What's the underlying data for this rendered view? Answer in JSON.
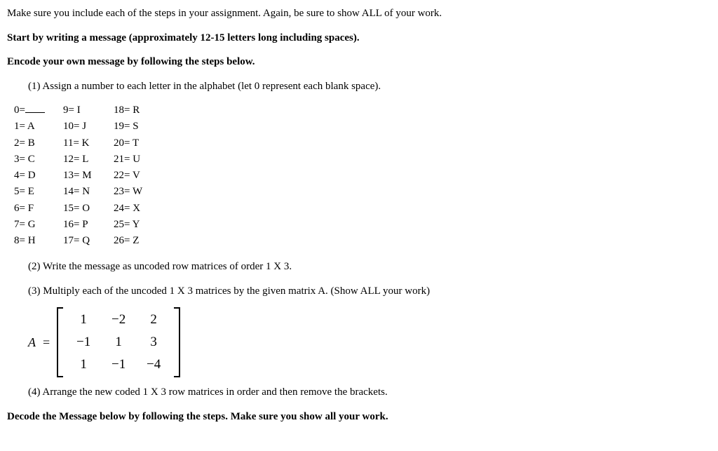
{
  "intro": "Make sure you include each of the steps in your assignment.  Again, be sure to show ALL of your work.",
  "start_msg": "Start by writing a message (approximately 12-15 letters long including spaces).",
  "encode_instr": "Encode your own message by following the steps below.",
  "step1": "(1) Assign a number to each letter in the alphabet (let 0 represent each blank space).",
  "alpha_table": {
    "col1": [
      "0=",
      "1= A",
      "2= B",
      "3= C",
      "4= D",
      "5= E",
      "6= F",
      "7= G",
      "8= H"
    ],
    "col2": [
      "9= I",
      "10= J",
      "11= K",
      "12= L",
      "13= M",
      "14= N",
      "15= O",
      "16= P",
      "17= Q"
    ],
    "col3": [
      "18= R",
      "19= S",
      "20= T",
      "21= U",
      "22= V",
      "23= W",
      "24= X",
      "25= Y",
      "26= Z"
    ]
  },
  "step2": "(2) Write the message as uncoded row matrices of order 1 X 3.",
  "step3": "(3) Multiply each of the uncoded 1 X 3 matrices by the given matrix A.  (Show ALL your work)",
  "matrix": {
    "label": "A",
    "equals": "=",
    "rows": [
      [
        "1",
        "−2",
        "2"
      ],
      [
        "−1",
        "1",
        "3"
      ],
      [
        "1",
        "−1",
        "−4"
      ]
    ]
  },
  "step4": "(4) Arrange the new coded 1 X 3 row matrices in order and then remove the brackets.",
  "decode_instr": "Decode the Message below by following the steps.  Make sure you show all your work."
}
